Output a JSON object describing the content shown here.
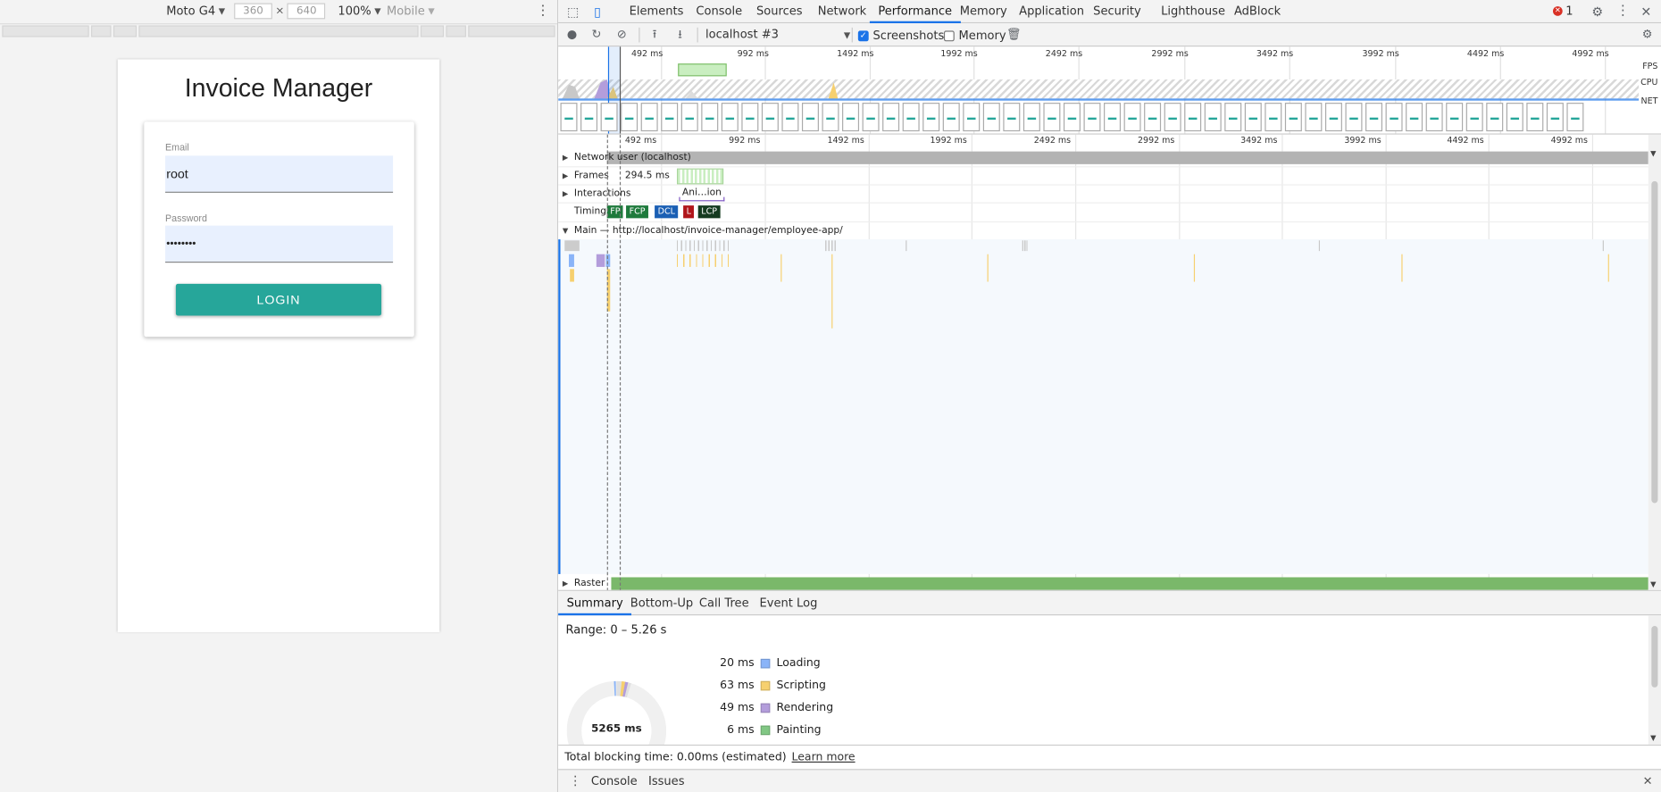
{
  "device_toolbar": {
    "device": "Moto G4",
    "width": "360",
    "times": "×",
    "height": "640",
    "zoom": "100%",
    "throttle": "Mobile",
    "more_icon": "more-vertical-icon"
  },
  "app": {
    "title": "Invoice Manager",
    "email_label": "Email",
    "email_value": "root",
    "password_label": "Password",
    "password_value": "••••••••",
    "login_label": "LOGIN",
    "accent": "#26a69a"
  },
  "devtools": {
    "tabs": [
      "Elements",
      "Console",
      "Sources",
      "Network",
      "Performance",
      "Memory",
      "Application",
      "Security",
      "Lighthouse",
      "AdBlock"
    ],
    "active_tab": "Performance",
    "error_count": "1",
    "accent": "#1a73e8"
  },
  "perf_toolbar": {
    "profile": "localhost #3",
    "screenshots_label": "Screenshots",
    "screenshots_checked": true,
    "memory_label": "Memory",
    "memory_checked": false
  },
  "overview": {
    "ticks": [
      "492 ms",
      "992 ms",
      "1492 ms",
      "1992 ms",
      "2492 ms",
      "2992 ms",
      "3492 ms",
      "3992 ms",
      "4492 ms",
      "4992 ms"
    ],
    "fps_label": "FPS",
    "cpu_label": "CPU",
    "net_label": "NET"
  },
  "timeline": {
    "ticks": [
      "492 ms",
      "992 ms",
      "1492 ms",
      "1992 ms",
      "2492 ms",
      "2992 ms",
      "3492 ms",
      "3992 ms",
      "4492 ms",
      "4992 ms"
    ],
    "network_label": "Network user (localhost)",
    "frames_label": "Frames",
    "frame_duration": "294.5 ms",
    "interactions_label": "Interactions",
    "interaction_name": "Ani…ion",
    "timings_label": "Timings",
    "timings": [
      {
        "label": "FP",
        "color": "#1e7a3c"
      },
      {
        "label": "FCP",
        "color": "#1e7a3c"
      },
      {
        "label": "DCL",
        "color": "#1a5fb4"
      },
      {
        "label": "L",
        "color": "#b0151a"
      },
      {
        "label": "LCP",
        "color": "#153b20"
      }
    ],
    "main_label": "Main — http://localhost/invoice-manager/employee-app/",
    "raster_label": "Raster"
  },
  "details": {
    "tabs": [
      "Summary",
      "Bottom-Up",
      "Call Tree",
      "Event Log"
    ],
    "active_tab": "Summary",
    "range": "Range: 0 – 5.26 s",
    "total": "5265 ms",
    "legend": [
      {
        "value": "20 ms",
        "label": "Loading",
        "color": "#8ab4f8"
      },
      {
        "value": "63 ms",
        "label": "Scripting",
        "color": "#f6d06f"
      },
      {
        "value": "49 ms",
        "label": "Rendering",
        "color": "#b39ddb"
      },
      {
        "value": "6 ms",
        "label": "Painting",
        "color": "#81c784"
      }
    ],
    "tbt": "Total blocking time: 0.00ms (estimated)",
    "learn_more": "Learn more"
  },
  "drawer": {
    "tabs": [
      "Console",
      "Issues"
    ]
  }
}
